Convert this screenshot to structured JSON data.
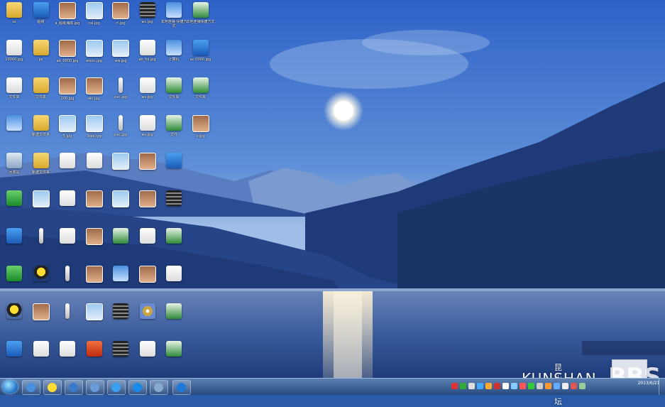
{
  "watermark": {
    "cn": "昆山论坛",
    "en": "KUNSHAN",
    "bbs": "BBS"
  },
  "clock": {
    "time": "",
    "date": "2013/6/21"
  },
  "desktop_icons": [
    {
      "name": "folder-icon",
      "type": "folder",
      "label": "ss",
      "col": 0,
      "row": 0
    },
    {
      "name": "app-icon",
      "type": "app",
      "label": "超级",
      "col": 1,
      "row": 0
    },
    {
      "name": "photo-icon",
      "type": "photo",
      "label": "a_超级海底.jpg",
      "col": 2,
      "row": 0
    },
    {
      "name": "image-icon",
      "type": "image",
      "label": "cal.jpg",
      "col": 3,
      "row": 0
    },
    {
      "name": "photo-icon",
      "type": "photo",
      "label": "cl.jpg",
      "col": 4,
      "row": 0
    },
    {
      "name": "film-icon",
      "type": "film",
      "label": "wc.jpg",
      "col": 5,
      "row": 0
    },
    {
      "name": "network-icon",
      "type": "net",
      "label": "本地连接-快捷方式",
      "col": 6,
      "row": 0
    },
    {
      "name": "excel-icon",
      "type": "excel",
      "label": "本地连接快捷方式",
      "col": 7,
      "row": 0
    },
    {
      "name": "doc-icon",
      "type": "doc",
      "label": "10000.jpg",
      "col": 0,
      "row": 1
    },
    {
      "name": "folder-icon",
      "type": "folder",
      "label": "ps",
      "col": 1,
      "row": 1
    },
    {
      "name": "photo-icon",
      "type": "photo",
      "label": "ab_0000.jpg",
      "col": 2,
      "row": 1
    },
    {
      "name": "image-icon",
      "type": "image",
      "label": "woon.jpg",
      "col": 3,
      "row": 1
    },
    {
      "name": "image-icon",
      "type": "image",
      "label": "ww.jpg",
      "col": 4,
      "row": 1
    },
    {
      "name": "gear-icon",
      "type": "doc",
      "label": "ab_fol.jpg",
      "col": 5,
      "row": 1
    },
    {
      "name": "computer-icon",
      "type": "net",
      "label": "计算机",
      "col": 6,
      "row": 1
    },
    {
      "name": "app-icon",
      "type": "app",
      "label": "ac 0000.jpg",
      "col": 7,
      "row": 1
    },
    {
      "name": "doc-icon",
      "type": "doc",
      "label": "文件夹",
      "col": 0,
      "row": 2
    },
    {
      "name": "folder-icon",
      "type": "folder",
      "label": "文件夹",
      "col": 1,
      "row": 2
    },
    {
      "name": "photo-icon",
      "type": "photo",
      "label": "100.jpg",
      "col": 2,
      "row": 2
    },
    {
      "name": "photo-icon",
      "type": "photo",
      "label": "wn.jpg",
      "col": 3,
      "row": 2
    },
    {
      "name": "strip-icon",
      "type": "strip",
      "label": "pxc.jpg",
      "col": 4,
      "row": 2
    },
    {
      "name": "doc-icon",
      "type": "doc",
      "label": "ws.jpg",
      "col": 5,
      "row": 2
    },
    {
      "name": "excel-icon",
      "type": "excel",
      "label": "文件夹",
      "col": 6,
      "row": 2
    },
    {
      "name": "excel-icon",
      "type": "excel",
      "label": "文件夹",
      "col": 7,
      "row": 2
    },
    {
      "name": "computer-icon",
      "type": "net",
      "label": "",
      "col": 0,
      "row": 3
    },
    {
      "name": "folder-icon",
      "type": "folder",
      "label": "新建文件夹",
      "col": 1,
      "row": 3
    },
    {
      "name": "image-icon",
      "type": "image",
      "label": "5.jpg",
      "col": 2,
      "row": 3
    },
    {
      "name": "image-icon",
      "type": "image",
      "label": "Stee.jpg",
      "col": 3,
      "row": 3
    },
    {
      "name": "strip-icon",
      "type": "strip",
      "label": "pxc.jpg",
      "col": 4,
      "row": 3
    },
    {
      "name": "doc-icon",
      "type": "doc",
      "label": "ws.jpg",
      "col": 5,
      "row": 3
    },
    {
      "name": "excel-icon",
      "type": "excel",
      "label": "文件",
      "col": 6,
      "row": 3
    },
    {
      "name": "photo-icon",
      "type": "photo",
      "label": "o.jpg",
      "col": 7,
      "row": 3
    },
    {
      "name": "recycle-bin-icon",
      "type": "bin",
      "label": "回收站",
      "col": 0,
      "row": 4
    },
    {
      "name": "folder-icon",
      "type": "folder",
      "label": "新建文件夹",
      "col": 1,
      "row": 4
    },
    {
      "name": "doc-icon",
      "type": "doc",
      "label": "",
      "col": 2,
      "row": 4
    },
    {
      "name": "doc-icon",
      "type": "doc",
      "label": "",
      "col": 3,
      "row": 4
    },
    {
      "name": "image-icon",
      "type": "image",
      "label": "",
      "col": 4,
      "row": 4
    },
    {
      "name": "photo-icon",
      "type": "photo",
      "label": "",
      "col": 5,
      "row": 4
    },
    {
      "name": "app-icon",
      "type": "app",
      "label": "",
      "col": 6,
      "row": 4
    },
    {
      "name": "green-app-icon",
      "type": "green",
      "label": "",
      "col": 0,
      "row": 5
    },
    {
      "name": "image-icon",
      "type": "image",
      "label": "",
      "col": 1,
      "row": 5
    },
    {
      "name": "doc-icon",
      "type": "doc",
      "label": "",
      "col": 2,
      "row": 5
    },
    {
      "name": "photo-icon",
      "type": "photo",
      "label": "",
      "col": 3,
      "row": 5
    },
    {
      "name": "image-icon",
      "type": "image",
      "label": "",
      "col": 4,
      "row": 5
    },
    {
      "name": "photo-icon",
      "type": "photo",
      "label": "",
      "col": 5,
      "row": 5
    },
    {
      "name": "film-icon",
      "type": "film",
      "label": "",
      "col": 6,
      "row": 5
    },
    {
      "name": "ie-icon",
      "type": "app",
      "label": "",
      "col": 0,
      "row": 6
    },
    {
      "name": "strip-icon",
      "type": "strip",
      "label": "",
      "col": 1,
      "row": 6
    },
    {
      "name": "doc-icon",
      "type": "doc",
      "label": "",
      "col": 2,
      "row": 6
    },
    {
      "name": "photo-icon",
      "type": "photo",
      "label": "",
      "col": 3,
      "row": 6
    },
    {
      "name": "excel-icon",
      "type": "excel",
      "label": "",
      "col": 4,
      "row": 6
    },
    {
      "name": "doc-icon",
      "type": "doc",
      "label": "",
      "col": 5,
      "row": 6
    },
    {
      "name": "excel-icon",
      "type": "excel",
      "label": "",
      "col": 6,
      "row": 6
    },
    {
      "name": "green-app-icon",
      "type": "green",
      "label": "",
      "col": 0,
      "row": 7
    },
    {
      "name": "qq-icon",
      "type": "qq",
      "label": "",
      "col": 1,
      "row": 7
    },
    {
      "name": "strip-icon",
      "type": "strip",
      "label": "",
      "col": 2,
      "row": 7
    },
    {
      "name": "photo-icon",
      "type": "photo",
      "label": "",
      "col": 3,
      "row": 7
    },
    {
      "name": "net-icon",
      "type": "net",
      "label": "",
      "col": 4,
      "row": 7
    },
    {
      "name": "photo-icon",
      "type": "photo",
      "label": "",
      "col": 5,
      "row": 7
    },
    {
      "name": "doc-icon",
      "type": "doc",
      "label": "",
      "col": 6,
      "row": 7
    },
    {
      "name": "qq-icon",
      "type": "qq",
      "label": "",
      "col": 0,
      "row": 8
    },
    {
      "name": "photo-icon",
      "type": "photo",
      "label": "",
      "col": 1,
      "row": 8
    },
    {
      "name": "strip-icon",
      "type": "strip",
      "label": "",
      "col": 2,
      "row": 8
    },
    {
      "name": "image-icon",
      "type": "image",
      "label": "",
      "col": 3,
      "row": 8
    },
    {
      "name": "film-icon",
      "type": "film",
      "label": "",
      "col": 4,
      "row": 8
    },
    {
      "name": "disk-icon",
      "type": "disk",
      "label": "",
      "col": 5,
      "row": 8
    },
    {
      "name": "excel-icon",
      "type": "excel",
      "label": "",
      "col": 6,
      "row": 8
    },
    {
      "name": "media-player-icon",
      "type": "app",
      "label": "",
      "col": 0,
      "row": 9
    },
    {
      "name": "doc-icon",
      "type": "doc",
      "label": "",
      "col": 1,
      "row": 9
    },
    {
      "name": "doc-icon",
      "type": "doc",
      "label": "",
      "col": 2,
      "row": 9
    },
    {
      "name": "red-app-icon",
      "type": "red",
      "label": "",
      "col": 3,
      "row": 9
    },
    {
      "name": "film-icon",
      "type": "film",
      "label": "",
      "col": 4,
      "row": 9
    },
    {
      "name": "doc-icon",
      "type": "doc",
      "label": "",
      "col": 5,
      "row": 9
    },
    {
      "name": "excel-icon",
      "type": "excel",
      "label": "",
      "col": 6,
      "row": 9
    }
  ],
  "taskbar_buttons": [
    {
      "name": "taskbar-network-icon",
      "color": "#4a90e0"
    },
    {
      "name": "taskbar-qq-icon",
      "color": "#ffdd33"
    },
    {
      "name": "taskbar-media-icon",
      "color": "#3a7ac8"
    },
    {
      "name": "taskbar-window-icon",
      "color": "#6a9ad8"
    },
    {
      "name": "taskbar-ie-icon",
      "color": "#3aa0f0"
    },
    {
      "name": "taskbar-k-icon",
      "color": "#1a8ae8"
    },
    {
      "name": "taskbar-shield-icon",
      "color": "#88aacc"
    },
    {
      "name": "taskbar-ie2-icon",
      "color": "#1e7ad8"
    }
  ],
  "tray_icons": [
    "#d33",
    "#3a3",
    "#ddd",
    "#4af",
    "#fa3",
    "#c33",
    "#fff",
    "#8cf",
    "#f55",
    "#3c3",
    "#ccc",
    "#f93",
    "#6af",
    "#eee",
    "#d55",
    "#9c9"
  ]
}
